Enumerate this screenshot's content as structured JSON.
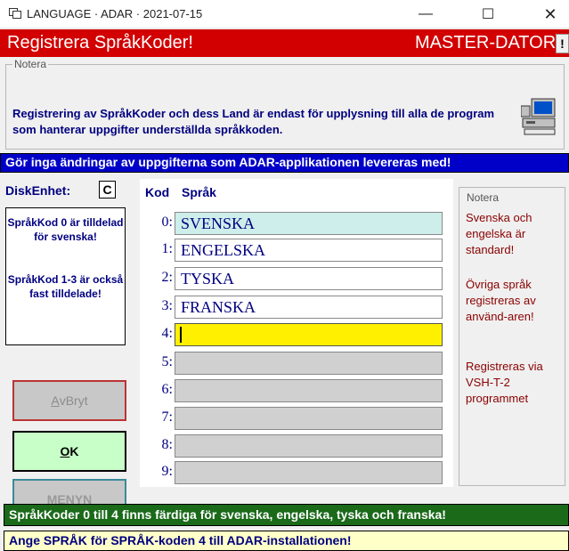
{
  "window": {
    "title": "LANGUAGE · ADAR · 2021-07-15",
    "minimize": "—",
    "maximize": "☐",
    "close": "✕"
  },
  "header": {
    "title": "Registrera SpråkKoder!",
    "right": "MASTER-DATORN",
    "excl": "!"
  },
  "notera": {
    "label": "Notera",
    "text": "Registrering av SpråkKoder och dess Land är endast för upplysning till alla de program som hanterar uppgifter underställda språkkoden."
  },
  "warning": "Gör inga ändringar av uppgifterna som ADAR-applikationen levereras med!",
  "disk": {
    "label": "DiskEnhet:",
    "value": "C"
  },
  "info": {
    "line1": "SpråkKod 0 är tilldelad för svenska!",
    "line2": "SpråkKod 1-3 är också fast tilldelade!"
  },
  "buttons": {
    "cancel": "AvBryt",
    "ok": "OK",
    "menu": "MENYN"
  },
  "grid": {
    "kod_header": "Kod",
    "sprak_header": "Språk",
    "rows": [
      {
        "label": "0:",
        "value": "SVENSKA"
      },
      {
        "label": "1:",
        "value": "ENGELSKA"
      },
      {
        "label": "2:",
        "value": "TYSKA"
      },
      {
        "label": "3:",
        "value": "FRANSKA"
      },
      {
        "label": "4:",
        "value": ""
      },
      {
        "label": "5:",
        "value": ""
      },
      {
        "label": "6:",
        "value": ""
      },
      {
        "label": "7:",
        "value": ""
      },
      {
        "label": "8:",
        "value": ""
      },
      {
        "label": "9:",
        "value": ""
      }
    ]
  },
  "side_note": {
    "label": "Notera",
    "p1": "Svenska och engelska är standard!",
    "p2": "Övriga språk registreras av använd-aren!",
    "p3": "Registreras via VSH-T-2 programmet"
  },
  "status": {
    "green": "SpråkKoder 0 till 4 finns färdiga för svenska, engelska, tyska och franska!",
    "yellow": "Ange SPRÅK för SPRÅK-koden 4 till ADAR-installationen!"
  },
  "colors": {
    "header_red": "#d20000",
    "warning_blue": "#0000c8",
    "status_green": "#1a6a1a",
    "active_field": "#fff000",
    "text_navy": "#000080"
  }
}
